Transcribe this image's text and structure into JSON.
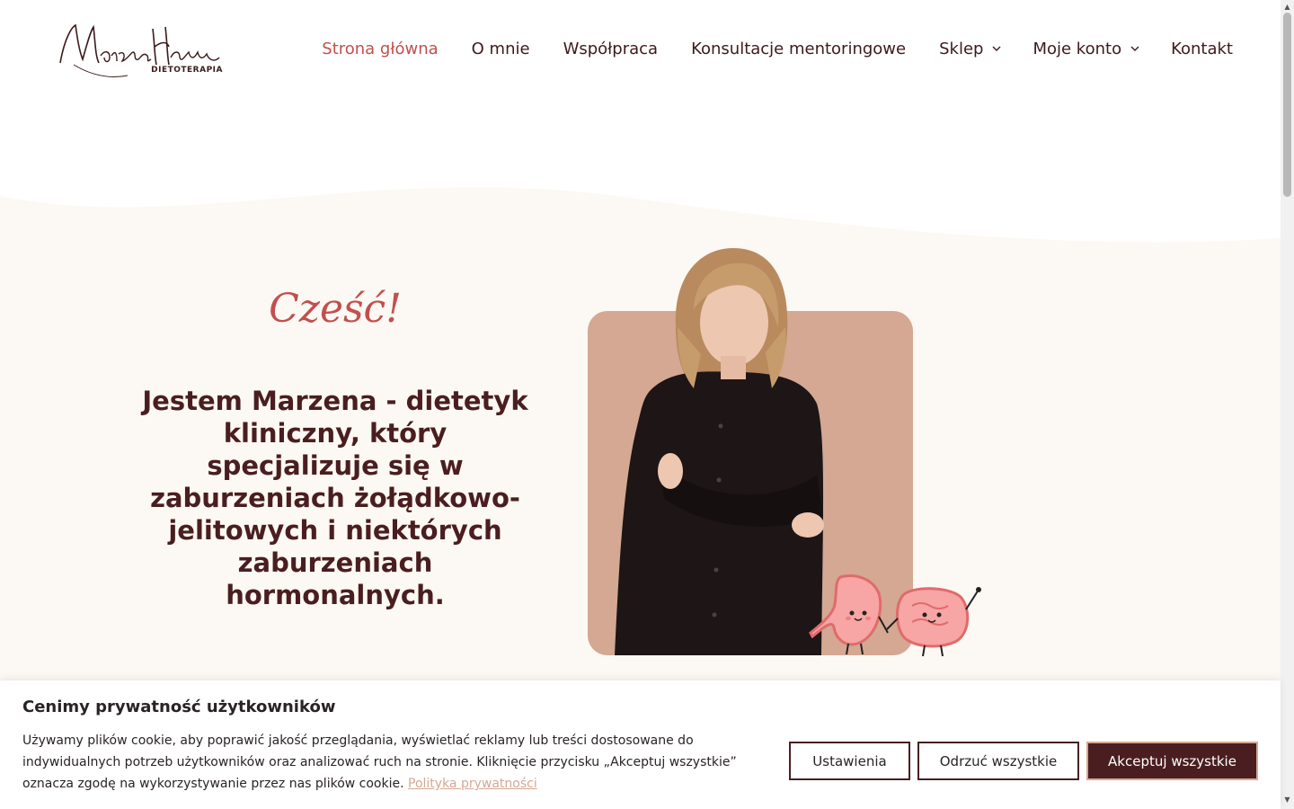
{
  "logo": {
    "name": "Marzena Hawka",
    "subtitle": "DIETOTERAPIA"
  },
  "nav": {
    "items": [
      {
        "label": "Strona główna",
        "active": true,
        "dropdown": false
      },
      {
        "label": "O mnie",
        "active": false,
        "dropdown": false
      },
      {
        "label": "Współpraca",
        "active": false,
        "dropdown": false
      },
      {
        "label": "Konsultacje mentoringowe",
        "active": false,
        "dropdown": false
      },
      {
        "label": "Sklep",
        "active": false,
        "dropdown": true
      },
      {
        "label": "Moje konto",
        "active": false,
        "dropdown": true
      },
      {
        "label": "Kontakt",
        "active": false,
        "dropdown": false
      }
    ]
  },
  "hero": {
    "greeting": "Cześć!",
    "headline": "Jestem Marzena - dietetyk kliniczny, który specjalizuje się w zaburzeniach żołądkowo-jelitowych i niektórych zaburzeniach hormonalnych."
  },
  "cookie": {
    "title": "Cenimy prywatność użytkowników",
    "text": "Używamy plików cookie, aby poprawić jakość przeglądania, wyświetlać reklamy lub treści dostosowane do indywidualnych potrzeb użytkowników oraz analizować ruch na stronie. Kliknięcie przycisku „Akceptuj wszystkie” oznacza zgodę na wykorzystywanie przez nas plików cookie.",
    "link": "Polityka prywatności",
    "buttons": {
      "settings": "Ustawienia",
      "reject": "Odrzuć wszystkie",
      "accept": "Akceptuj wszystkie"
    }
  },
  "colors": {
    "accent": "#c0504f",
    "dark": "#4a1e20",
    "cream": "#fcf8f3",
    "card": "#d4a892"
  }
}
